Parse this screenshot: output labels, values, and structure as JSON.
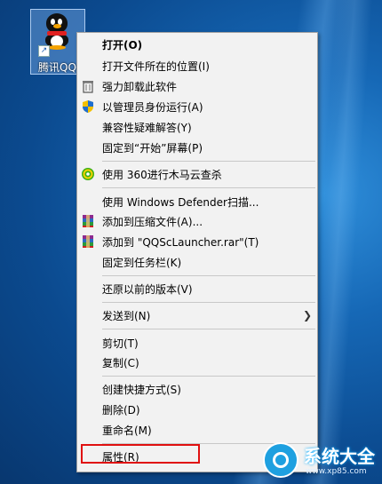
{
  "desktop_icon": {
    "label": "腾讯QQ"
  },
  "menu": {
    "items": [
      {
        "label": "打开(O)"
      },
      {
        "label": "打开文件所在的位置(I)"
      },
      {
        "label": "强力卸载此软件"
      },
      {
        "label": "以管理员身份运行(A)"
      },
      {
        "label": "兼容性疑难解答(Y)"
      },
      {
        "label": "固定到“开始”屏幕(P)"
      },
      {
        "label": "使用 360进行木马云查杀"
      },
      {
        "label": "使用 Windows Defender扫描..."
      },
      {
        "label": "添加到压缩文件(A)..."
      },
      {
        "label": "添加到 \"QQScLauncher.rar\"(T)"
      },
      {
        "label": "固定到任务栏(K)"
      },
      {
        "label": "还原以前的版本(V)"
      },
      {
        "label": "发送到(N)"
      },
      {
        "label": "剪切(T)"
      },
      {
        "label": "复制(C)"
      },
      {
        "label": "创建快捷方式(S)"
      },
      {
        "label": "删除(D)"
      },
      {
        "label": "重命名(M)"
      },
      {
        "label": "属性(R)"
      }
    ]
  },
  "watermark": {
    "title": "系统大全",
    "url": "www.xp85.com"
  }
}
